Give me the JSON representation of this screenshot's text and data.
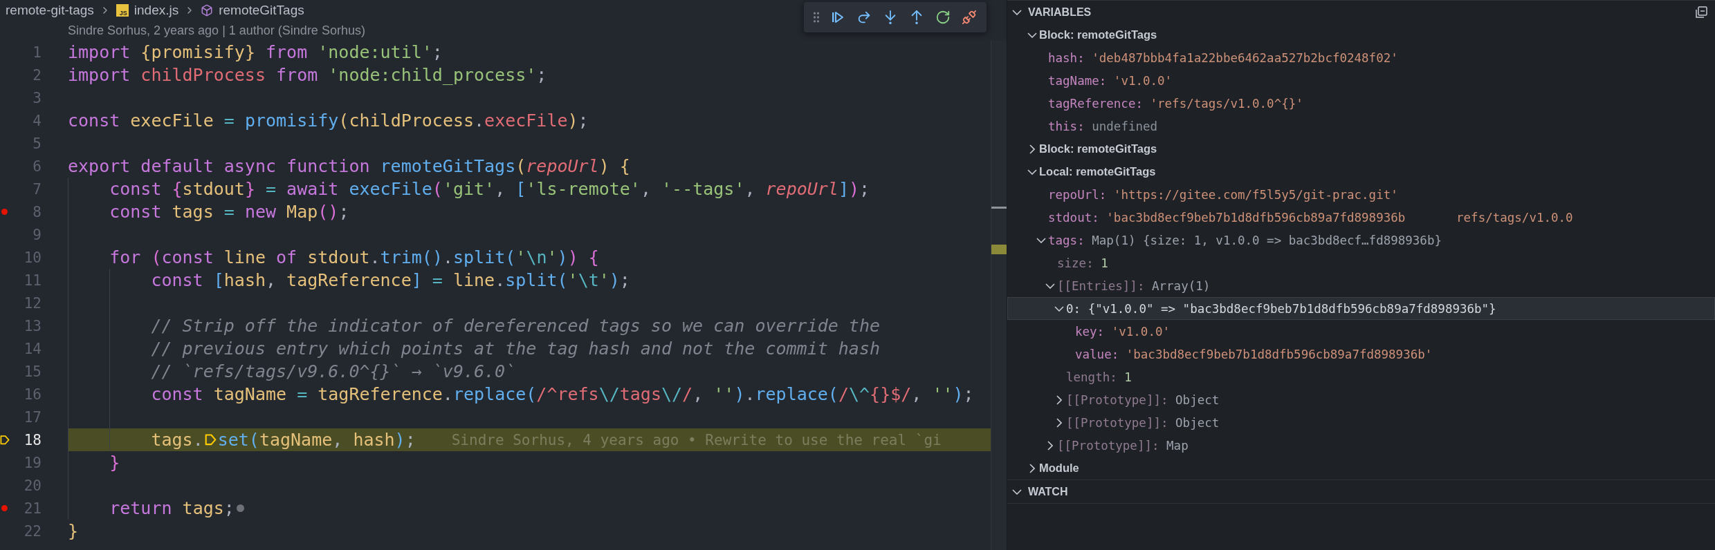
{
  "breadcrumb": [
    {
      "kind": "folder",
      "label": "remote-git-tags"
    },
    {
      "kind": "js-file",
      "label": "index.js",
      "badge": "JS"
    },
    {
      "kind": "symbol",
      "label": "remoteGitTags"
    }
  ],
  "debug_toolbar": {
    "buttons": [
      {
        "kind": "grip"
      },
      {
        "kind": "continue"
      },
      {
        "kind": "step-over"
      },
      {
        "kind": "step-into"
      },
      {
        "kind": "step-out"
      },
      {
        "kind": "restart"
      },
      {
        "kind": "disconnect"
      }
    ]
  },
  "codelens": "Sindre Sorhus, 2 years ago | 1 author (Sindre Sorhus)",
  "lines": [
    {
      "number": "1",
      "breakpoint": false,
      "current": false,
      "tokens": [
        {
          "kind": "kw",
          "text": "import "
        },
        {
          "kind": "b1",
          "text": "{"
        },
        {
          "kind": "var",
          "text": "promisify"
        },
        {
          "kind": "b1",
          "text": "}"
        },
        {
          "kind": "kw",
          "text": " from "
        },
        {
          "kind": "str",
          "text": "'node:util'"
        },
        {
          "kind": "plain",
          "text": ";"
        }
      ]
    },
    {
      "number": "2",
      "breakpoint": false,
      "current": false,
      "tokens": [
        {
          "kind": "kw",
          "text": "import "
        },
        {
          "kind": "red",
          "text": "childProcess"
        },
        {
          "kind": "kw",
          "text": " from "
        },
        {
          "kind": "str",
          "text": "'node:child_process'"
        },
        {
          "kind": "plain",
          "text": ";"
        }
      ]
    },
    {
      "number": "3",
      "breakpoint": false,
      "current": false
    },
    {
      "number": "4",
      "breakpoint": false,
      "current": false,
      "tokens": [
        {
          "kind": "kw",
          "text": "const "
        },
        {
          "kind": "var",
          "text": "execFile"
        },
        {
          "kind": "op",
          "text": " = "
        },
        {
          "kind": "fn",
          "text": "promisify"
        },
        {
          "kind": "b1",
          "text": "("
        },
        {
          "kind": "var",
          "text": "childProcess"
        },
        {
          "kind": "plain",
          "text": "."
        },
        {
          "kind": "red",
          "text": "execFile"
        },
        {
          "kind": "b1",
          "text": ")"
        },
        {
          "kind": "plain",
          "text": ";"
        }
      ]
    },
    {
      "number": "5",
      "breakpoint": false,
      "current": false
    },
    {
      "number": "6",
      "breakpoint": false,
      "current": false,
      "tokens": [
        {
          "kind": "kw",
          "text": "export default async function "
        },
        {
          "kind": "fn",
          "text": "remoteGitTags"
        },
        {
          "kind": "b1",
          "text": "("
        },
        {
          "kind": "param",
          "text": "repoUrl"
        },
        {
          "kind": "b1",
          "text": ") {"
        }
      ]
    },
    {
      "number": "7",
      "breakpoint": false,
      "current": false,
      "tokens": [
        {
          "kind": "kw",
          "text": "    const "
        },
        {
          "kind": "b2",
          "text": "{"
        },
        {
          "kind": "var",
          "text": "stdout"
        },
        {
          "kind": "b2",
          "text": "}"
        },
        {
          "kind": "op",
          "text": " = "
        },
        {
          "kind": "kw",
          "text": "await "
        },
        {
          "kind": "fn",
          "text": "execFile"
        },
        {
          "kind": "b2",
          "text": "("
        },
        {
          "kind": "str",
          "text": "'git'"
        },
        {
          "kind": "plain",
          "text": ", "
        },
        {
          "kind": "b3",
          "text": "["
        },
        {
          "kind": "str",
          "text": "'ls-remote'"
        },
        {
          "kind": "plain",
          "text": ", "
        },
        {
          "kind": "str",
          "text": "'--tags'"
        },
        {
          "kind": "plain",
          "text": ", "
        },
        {
          "kind": "param",
          "text": "repoUrl"
        },
        {
          "kind": "b3",
          "text": "]"
        },
        {
          "kind": "b2",
          "text": ")"
        },
        {
          "kind": "plain",
          "text": ";"
        }
      ]
    },
    {
      "number": "8",
      "breakpoint": true,
      "current": false,
      "tokens": [
        {
          "kind": "kw",
          "text": "    const "
        },
        {
          "kind": "var",
          "text": "tags"
        },
        {
          "kind": "op",
          "text": " = "
        },
        {
          "kind": "kw",
          "text": "new "
        },
        {
          "kind": "var",
          "text": "Map"
        },
        {
          "kind": "b2",
          "text": "()"
        },
        {
          "kind": "plain",
          "text": ";"
        }
      ]
    },
    {
      "number": "9",
      "breakpoint": false,
      "current": false
    },
    {
      "number": "10",
      "breakpoint": false,
      "current": false,
      "tokens": [
        {
          "kind": "kw",
          "text": "    for "
        },
        {
          "kind": "b2",
          "text": "("
        },
        {
          "kind": "kw",
          "text": "const "
        },
        {
          "kind": "var",
          "text": "line"
        },
        {
          "kind": "kw",
          "text": " of "
        },
        {
          "kind": "var",
          "text": "stdout"
        },
        {
          "kind": "plain",
          "text": "."
        },
        {
          "kind": "fn",
          "text": "trim"
        },
        {
          "kind": "b3",
          "text": "()"
        },
        {
          "kind": "plain",
          "text": "."
        },
        {
          "kind": "fn",
          "text": "split"
        },
        {
          "kind": "b3",
          "text": "("
        },
        {
          "kind": "str",
          "text": "'"
        },
        {
          "kind": "esc",
          "text": "\\n"
        },
        {
          "kind": "str",
          "text": "'"
        },
        {
          "kind": "b3",
          "text": ")"
        },
        {
          "kind": "b2",
          "text": ") {"
        }
      ]
    },
    {
      "number": "11",
      "breakpoint": false,
      "current": false,
      "tokens": [
        {
          "kind": "kw",
          "text": "        const "
        },
        {
          "kind": "b3",
          "text": "["
        },
        {
          "kind": "var",
          "text": "hash"
        },
        {
          "kind": "plain",
          "text": ", "
        },
        {
          "kind": "var",
          "text": "tagReference"
        },
        {
          "kind": "b3",
          "text": "]"
        },
        {
          "kind": "op",
          "text": " = "
        },
        {
          "kind": "var",
          "text": "line"
        },
        {
          "kind": "plain",
          "text": "."
        },
        {
          "kind": "fn",
          "text": "split"
        },
        {
          "kind": "b3",
          "text": "("
        },
        {
          "kind": "str",
          "text": "'"
        },
        {
          "kind": "esc",
          "text": "\\t"
        },
        {
          "kind": "str",
          "text": "'"
        },
        {
          "kind": "b3",
          "text": ")"
        },
        {
          "kind": "plain",
          "text": ";"
        }
      ]
    },
    {
      "number": "12",
      "breakpoint": false,
      "current": false
    },
    {
      "number": "13",
      "breakpoint": false,
      "current": false,
      "tokens": [
        {
          "kind": "comment",
          "text": "        // Strip off the indicator of dereferenced tags so we can override the"
        }
      ]
    },
    {
      "number": "14",
      "breakpoint": false,
      "current": false,
      "tokens": [
        {
          "kind": "comment",
          "text": "        // previous entry which points at the tag hash and not the commit hash"
        }
      ]
    },
    {
      "number": "15",
      "breakpoint": false,
      "current": false,
      "tokens": [
        {
          "kind": "comment",
          "text": "        // `refs/tags/v9.6.0^{}` → `v9.6.0`"
        }
      ]
    },
    {
      "number": "16",
      "breakpoint": false,
      "current": false,
      "tokens": [
        {
          "kind": "kw",
          "text": "        const "
        },
        {
          "kind": "var",
          "text": "tagName"
        },
        {
          "kind": "op",
          "text": " = "
        },
        {
          "kind": "var",
          "text": "tagReference"
        },
        {
          "kind": "plain",
          "text": "."
        },
        {
          "kind": "fn",
          "text": "replace"
        },
        {
          "kind": "b3",
          "text": "("
        },
        {
          "kind": "regex",
          "text": "/^refs"
        },
        {
          "kind": "esc",
          "text": "\\/"
        },
        {
          "kind": "regex",
          "text": "tags"
        },
        {
          "kind": "esc",
          "text": "\\/"
        },
        {
          "kind": "regex",
          "text": "/"
        },
        {
          "kind": "plain",
          "text": ", "
        },
        {
          "kind": "str",
          "text": "''"
        },
        {
          "kind": "b3",
          "text": ")"
        },
        {
          "kind": "plain",
          "text": "."
        },
        {
          "kind": "fn",
          "text": "replace"
        },
        {
          "kind": "b3",
          "text": "("
        },
        {
          "kind": "regex",
          "text": "/"
        },
        {
          "kind": "esc",
          "text": "\\^"
        },
        {
          "kind": "regex",
          "text": "{}$/"
        },
        {
          "kind": "plain",
          "text": ", "
        },
        {
          "kind": "str",
          "text": "''"
        },
        {
          "kind": "b3",
          "text": ")"
        },
        {
          "kind": "plain",
          "text": ";"
        }
      ]
    },
    {
      "number": "17",
      "breakpoint": false,
      "current": false
    },
    {
      "number": "18",
      "breakpoint": false,
      "current": true,
      "tokens": [
        {
          "kind": "var",
          "text": "        tags"
        },
        {
          "kind": "plain",
          "text": "."
        },
        {
          "kind": "stack_marker"
        },
        {
          "kind": "fn",
          "text": "set"
        },
        {
          "kind": "b3",
          "text": "("
        },
        {
          "kind": "var",
          "text": "tagName"
        },
        {
          "kind": "plain",
          "text": ", "
        },
        {
          "kind": "var",
          "text": "hash"
        },
        {
          "kind": "b3",
          "text": ")"
        },
        {
          "kind": "plain",
          "text": ";"
        }
      ],
      "blame": "Sindre Sorhus, 4 years ago • Rewrite to use the real `gi"
    },
    {
      "number": "19",
      "breakpoint": false,
      "current": false,
      "tokens": [
        {
          "kind": "b2",
          "text": "    }"
        }
      ]
    },
    {
      "number": "20",
      "breakpoint": false,
      "current": false
    },
    {
      "number": "21",
      "breakpoint": true,
      "current": false,
      "tokens": [
        {
          "kind": "kw",
          "text": "    return "
        },
        {
          "kind": "var",
          "text": "tags"
        },
        {
          "kind": "plain",
          "text": ";"
        },
        {
          "kind": "dot_marker"
        }
      ]
    },
    {
      "number": "22",
      "breakpoint": false,
      "current": false,
      "tokens": [
        {
          "kind": "b1",
          "text": "}"
        }
      ]
    }
  ],
  "variables": {
    "title": "VARIABLES",
    "expanded": true,
    "items": [
      {
        "kind": "scope",
        "name": "Block: remoteGitTags",
        "expanded": true,
        "selected": false,
        "children": [
          {
            "kind": "string",
            "name": "hash:",
            "value": "'deb487bbb4fa1a22bbe6462aa527b2bcf0248f02'",
            "internal": false,
            "selected": false
          },
          {
            "kind": "string",
            "name": "tagName:",
            "value": "'v1.0.0'",
            "internal": false,
            "selected": false
          },
          {
            "kind": "string",
            "name": "tagReference:",
            "value": "'refs/tags/v1.0.0^{}'",
            "internal": false,
            "selected": false
          },
          {
            "kind": "undefined",
            "name": "this:",
            "value": "undefined",
            "internal": false,
            "selected": false
          }
        ]
      },
      {
        "kind": "scope",
        "name": "Block: remoteGitTags",
        "expanded": false,
        "selected": false
      },
      {
        "kind": "scope",
        "name": "Local: remoteGitTags",
        "expanded": true,
        "selected": false,
        "children": [
          {
            "kind": "string",
            "name": "repoUrl:",
            "value": "'https://gitee.com/f5l5y5/git-prac.git'",
            "internal": false,
            "selected": false
          },
          {
            "kind": "string",
            "name": "stdout:",
            "value": "'bac3bd8ecf9beb7b1d8dfb596cb89a7fd898936b       refs/tags/v1.0.0",
            "internal": false,
            "selected": false
          },
          {
            "kind": "object",
            "name": "tags:",
            "value": "Map(1) {size: 1, v1.0.0 => bac3bd8ecf…fd898936b}",
            "internal": false,
            "expanded": true,
            "selected": false,
            "children": [
              {
                "kind": "number",
                "name": "size:",
                "value": "1",
                "internal": true,
                "selected": false
              },
              {
                "kind": "object",
                "name": "[[Entries]]:",
                "value": "Array(1)",
                "internal": true,
                "expanded": true,
                "selected": false,
                "children": [
                  {
                    "kind": "entry",
                    "name": "0:",
                    "value": "{\"v1.0.0\" => \"bac3bd8ecf9beb7b1d8dfb596cb89a7fd898936b\"}",
                    "internal": false,
                    "expanded": true,
                    "selected": true,
                    "children": [
                      {
                        "kind": "string",
                        "name": "key:",
                        "value": "'v1.0.0'",
                        "internal": false,
                        "selected": false
                      },
                      {
                        "kind": "string",
                        "name": "value:",
                        "value": "'bac3bd8ecf9beb7b1d8dfb596cb89a7fd898936b'",
                        "internal": false,
                        "selected": false
                      }
                    ]
                  },
                  {
                    "kind": "number",
                    "name": "length:",
                    "value": "1",
                    "internal": true,
                    "selected": false
                  },
                  {
                    "kind": "object",
                    "name": "[[Prototype]]:",
                    "value": "Object",
                    "internal": true,
                    "expanded": false,
                    "selected": false
                  },
                  {
                    "kind": "object",
                    "name": "[[Prototype]]:",
                    "value": "Object",
                    "internal": true,
                    "expanded": false,
                    "selected": false
                  }
                ]
              },
              {
                "kind": "object",
                "name": "[[Prototype]]:",
                "value": "Map",
                "internal": true,
                "expanded": false,
                "selected": false
              }
            ]
          }
        ]
      },
      {
        "kind": "scope",
        "name": "Module",
        "expanded": false,
        "selected": false
      }
    ]
  },
  "watch": {
    "title": "WATCH",
    "expanded": true
  }
}
